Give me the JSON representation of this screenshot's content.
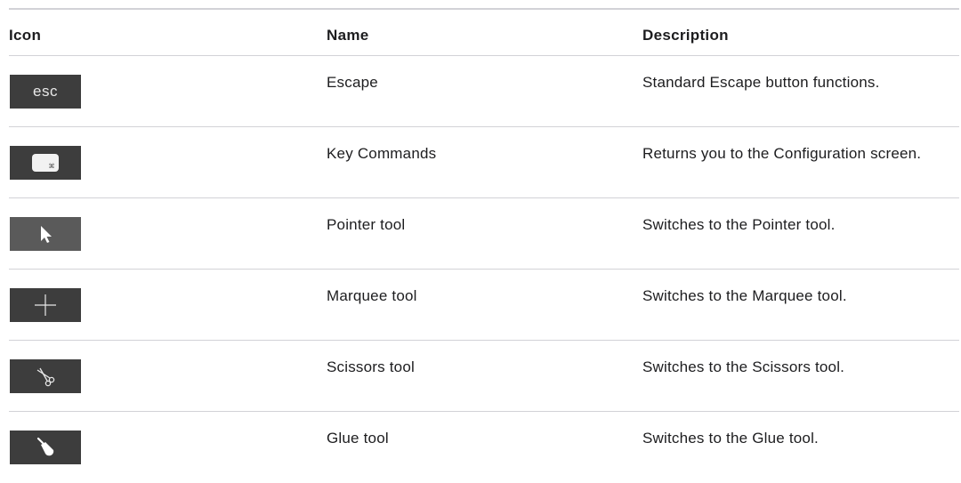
{
  "headers": {
    "icon": "Icon",
    "name": "Name",
    "description": "Description"
  },
  "rows": [
    {
      "icon": "esc-key-icon",
      "icon_text": "esc",
      "name": "Escape",
      "description": "Standard Escape button functions."
    },
    {
      "icon": "key-commands-icon",
      "name": "Key Commands",
      "description": "Returns you to the Configuration screen."
    },
    {
      "icon": "pointer-arrow-icon",
      "name": "Pointer tool",
      "description": "Switches to the Pointer tool."
    },
    {
      "icon": "crosshair-icon",
      "name": "Marquee tool",
      "description": "Switches to the Marquee tool."
    },
    {
      "icon": "scissors-icon",
      "name": "Scissors tool",
      "description": "Switches to the Scissors tool."
    },
    {
      "icon": "glue-bottle-icon",
      "name": "Glue tool",
      "description": "Switches to the Glue tool."
    }
  ]
}
